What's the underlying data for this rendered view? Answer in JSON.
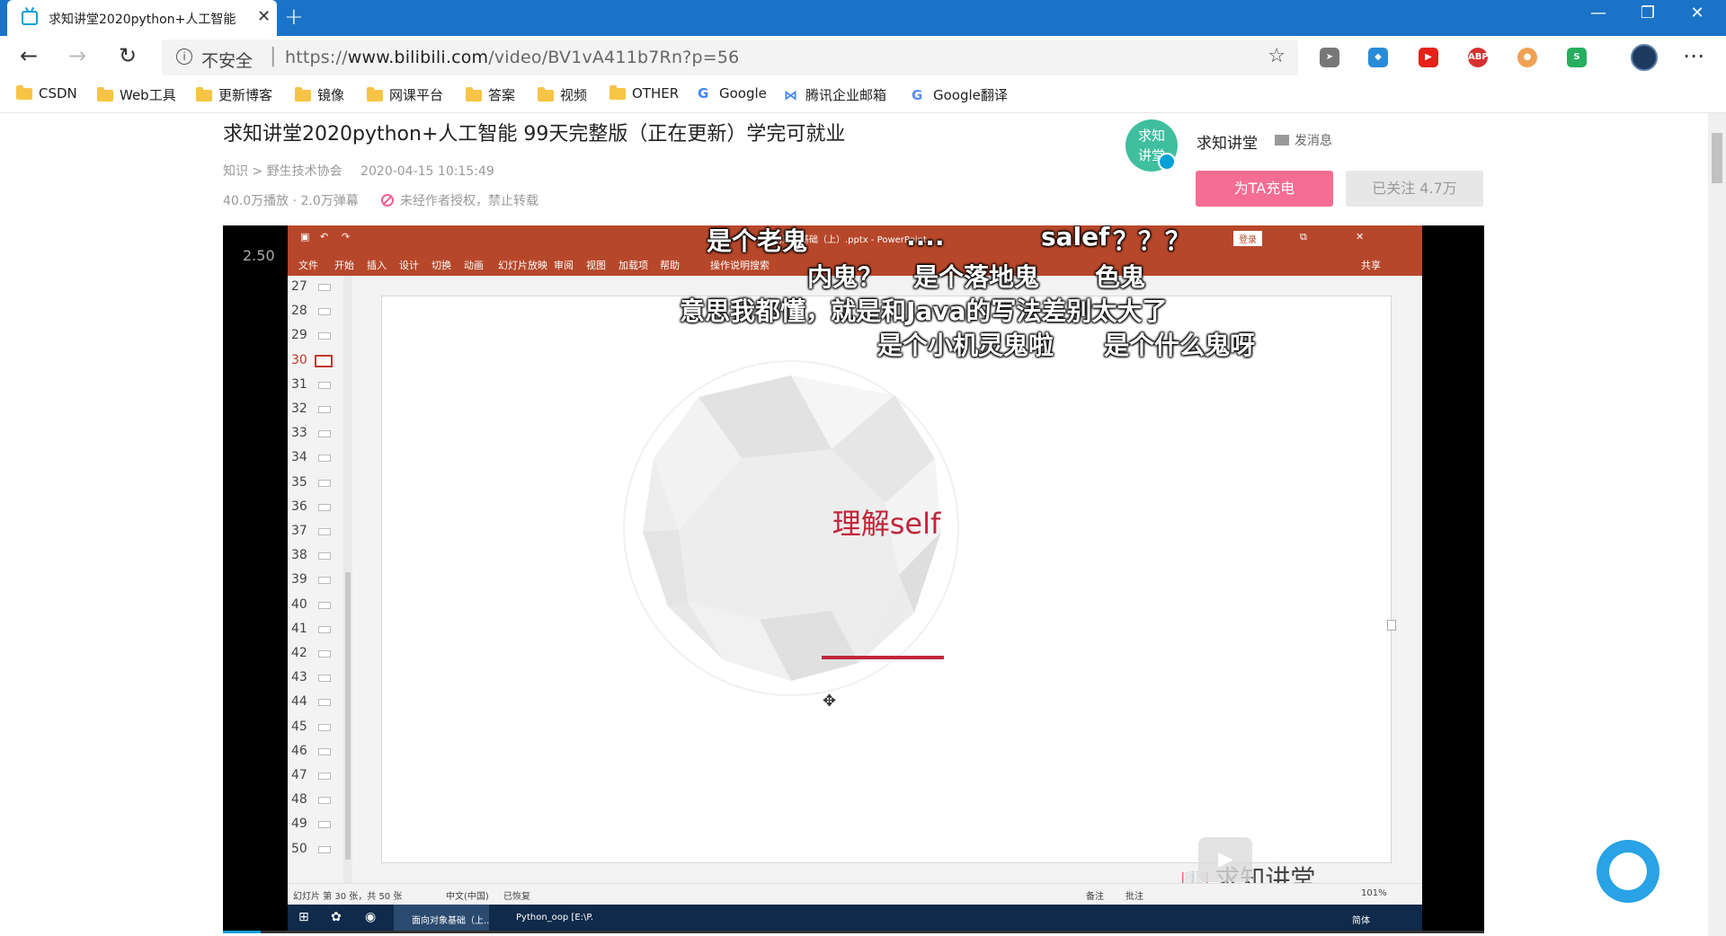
{
  "browser": {
    "tab_title": "求知讲堂2020python+人工智能",
    "tab_close": "✕",
    "new_tab": "+",
    "window_controls": [
      "—",
      "❐",
      "✕"
    ],
    "nav": {
      "back": "←",
      "forward": "→",
      "reload": "↻"
    },
    "insecure_label": "不安全",
    "separator": "|",
    "url_prefix": "https://",
    "url_host": "www.bilibili.com",
    "url_path": "/video/BV1vA411b7Rn?p=56",
    "star": "☆",
    "menu": "⋯",
    "extensions": [
      {
        "name": "cursor-ext-icon",
        "label": "➤",
        "color": "#777777"
      },
      {
        "name": "shield-ext-icon",
        "label": "◆",
        "color": "#2a8bd6"
      },
      {
        "name": "youtube-ext-icon",
        "label": "▶",
        "color": "#e62117"
      },
      {
        "name": "adblock-ext-icon",
        "label": "ABP",
        "color": "#d63031"
      },
      {
        "name": "orange-ext-icon",
        "label": "●",
        "color": "#f0a052"
      },
      {
        "name": "s-ext-icon",
        "label": "S",
        "color": "#27ae60"
      }
    ]
  },
  "bookmarks": [
    {
      "label": "CSDN",
      "type": "folder"
    },
    {
      "label": "Web工具",
      "type": "folder"
    },
    {
      "label": "更新博客",
      "type": "folder"
    },
    {
      "label": "镜像",
      "type": "folder"
    },
    {
      "label": "网课平台",
      "type": "folder"
    },
    {
      "label": "答案",
      "type": "folder"
    },
    {
      "label": "视频",
      "type": "folder"
    },
    {
      "label": "OTHER",
      "type": "folder"
    },
    {
      "label": "Google",
      "type": "site",
      "icon": "G"
    },
    {
      "label": "腾讯企业邮箱",
      "type": "site",
      "icon": "⋈"
    },
    {
      "label": "Google翻译",
      "type": "site",
      "icon": "G"
    }
  ],
  "video": {
    "title": "求知讲堂2020python+人工智能 99天完整版（正在更新）学完可就业",
    "category": "知识",
    "subcategory": "野生技术协会",
    "category_sep": ">",
    "date": "2020-04-15 10:15:49",
    "stats": "40.0万播放 · 2.0万弹幕",
    "no_repost": "未经作者授权，禁止转载",
    "badge": "2.50",
    "progress": 0.03
  },
  "uploader": {
    "avatar_text": "求知\n讲堂",
    "name": "求知讲堂",
    "message": "发消息",
    "charge": "为TA充电",
    "follow": "已关注 4.7万"
  },
  "ppt": {
    "doc_title": "面向对象基础（上）.pptx - PowerPoint",
    "login": "登录",
    "share": "共享",
    "ribbon": [
      "文件",
      "开始",
      "插入",
      "设计",
      "切换",
      "动画",
      "幻灯片放映",
      "审阅",
      "视图",
      "加载项",
      "帮助",
      "操作说明搜索"
    ],
    "slide_numbers": [
      "27",
      "28",
      "29",
      "30",
      "31",
      "32",
      "33",
      "34",
      "35",
      "36",
      "37",
      "38",
      "39",
      "40",
      "41",
      "42",
      "43",
      "44",
      "45",
      "46",
      "47",
      "48",
      "49",
      "50"
    ],
    "selected_slide": "30",
    "slide_heading": "理解self",
    "watermark": "求知讲堂",
    "status_slide": "幻灯片 第 30 张，共 50 张",
    "status_lang": "中文(中国)",
    "status_restored": "已恢复",
    "status_notes": "备注",
    "status_comments": "批注",
    "zoom": "101%",
    "taskbar_ppt": "面向对象基础（上...",
    "taskbar_py": "Python_oop [E:\\P...",
    "taskbar_ime": "简体"
  },
  "danmaku": [
    "是个老鬼",
    "....",
    "salef",
    "？？",
    "？",
    "内鬼？",
    "是个落地鬼",
    "色鬼",
    "意思我都懂，就是和Java的写法差别太大了",
    "是个小机灵鬼啦",
    "是个什么鬼呀"
  ]
}
